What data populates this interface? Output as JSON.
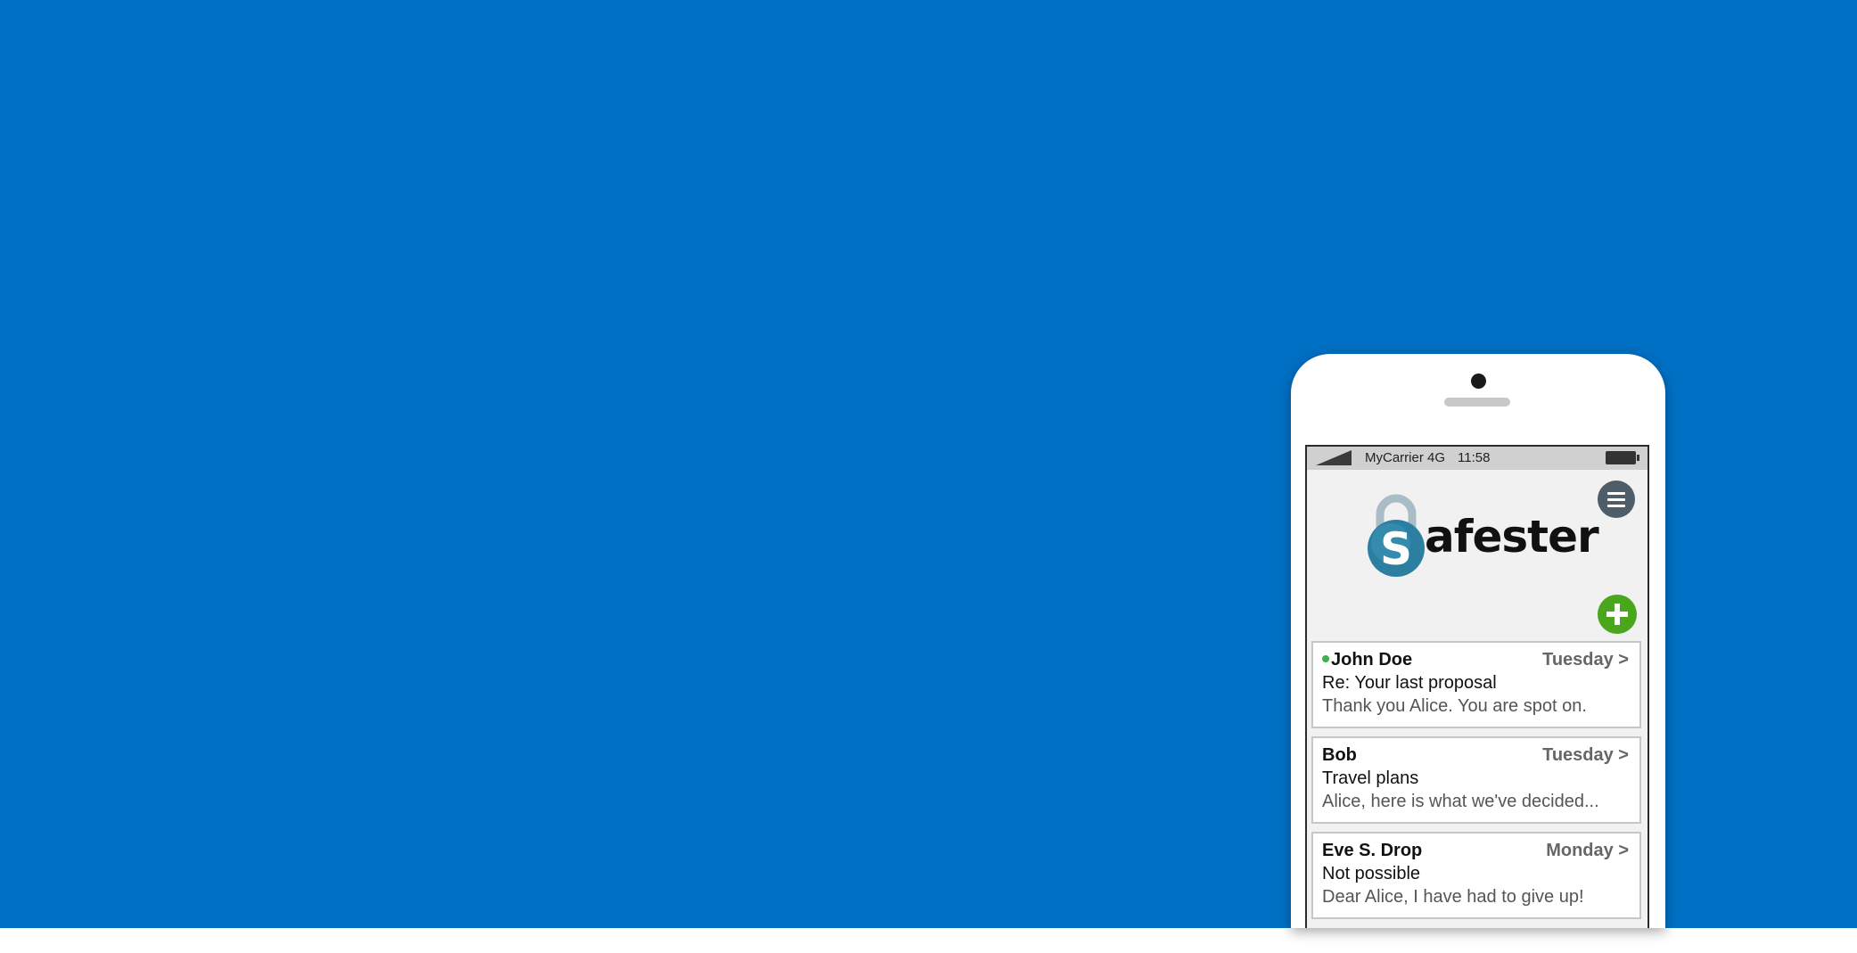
{
  "colors": {
    "background": "#0070c4",
    "accent_add": "#4aa61c",
    "unread": "#3cb14a",
    "logo_blue": "#2d7fa1"
  },
  "status_bar": {
    "carrier": "MyCarrier 4G",
    "time": "11:58"
  },
  "app": {
    "logo_text": "afester",
    "logo_letter": "S"
  },
  "messages": [
    {
      "sender": "John Doe",
      "date": "Tuesday >",
      "subject": "Re: Your last proposal",
      "preview": "Thank you Alice. You are spot on.",
      "unread": true
    },
    {
      "sender": "Bob",
      "date": "Tuesday >",
      "subject": "Travel plans",
      "preview": "Alice, here is what we've decided...",
      "unread": false
    },
    {
      "sender": "Eve S. Drop",
      "date": "Monday >",
      "subject": "Not possible",
      "preview": "Dear Alice, I have had to give up!",
      "unread": false
    }
  ]
}
